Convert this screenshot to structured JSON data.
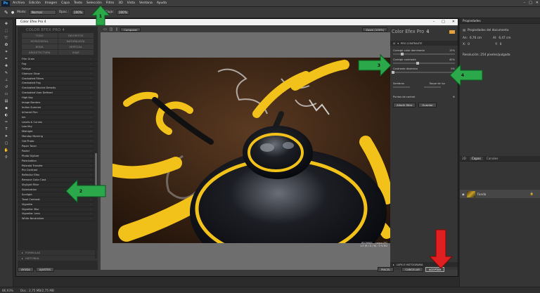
{
  "menubar": {
    "logo": "Ps",
    "items": [
      "Archivo",
      "Edición",
      "Imagen",
      "Capa",
      "Texto",
      "Selección",
      "Filtro",
      "3D",
      "Vista",
      "Ventana",
      "Ayuda"
    ]
  },
  "optbar": {
    "mode_label": "Modo:",
    "mode_value": "Normal",
    "opacity_label": "Opac.:",
    "opacity_value": "100%",
    "flow_label": "Flujo:",
    "flow_value": "100%"
  },
  "cep": {
    "window_title": "Color Efex Pro 4",
    "brand": "COLOR EFEX PRO 4",
    "categories": [
      "TODO",
      "FAVORITOS",
      "HORIZONTAL",
      "NATURALEZA",
      "BODA",
      "VERTICAL",
      "ARQUITECTURA",
      "VIAJE"
    ],
    "filters": [
      "Film Grain",
      "Fog",
      "Foliage",
      "Glamour Glow",
      "Graduated Filters",
      "Graduated Fog",
      "Graduated Neutral Density",
      "Graduated User Defined",
      "High Key",
      "Image Borders",
      "Indian Summer",
      "Infrared Film",
      "Ink",
      "Levels & Curves",
      "Low Key",
      "Midnight",
      "Monday Morning",
      "Old Photo",
      "Paper Toner",
      "Pastel",
      "Photo Stylizer",
      "Polarization",
      "Polaroid Transfer",
      "Pro Contrast",
      "Reflector Efex",
      "Remove Color Cast",
      "Skylight Filter",
      "Solarization",
      "Sunlight",
      "Tonal Contrast",
      "Vignette",
      "Vignette: Blur",
      "Vignette: Lens",
      "White Neutralizer"
    ],
    "sections": [
      "FORMULAS",
      "HISTORIAL"
    ],
    "left_buttons": [
      "AYUDA",
      "AJUSTES"
    ],
    "compare_label": "Comparar",
    "zoom_label": "Zoom (100%)",
    "logo_text": "Color Efex Pro",
    "logo_version": "4",
    "filter_section": "PRO CONTRASTE",
    "controls": [
      {
        "label": "Corregir color dominante",
        "value": "15%",
        "level": 0.15
      },
      {
        "label": "Corregir contraste",
        "value": "40%",
        "level": 0.4
      },
      {
        "label": "Contraste dinámico",
        "value": "0%",
        "level": 0.0
      }
    ],
    "shadows_label": "Sombras",
    "highlights_label": "Toque de luz",
    "control_points_label": "Puntos de control",
    "add_filter_label": "Añadir filtro",
    "save_label": "Guardar",
    "loupe_label": "LUPA E HISTOGRAMA",
    "brush_label": "PINCEL",
    "cancel_label": "CANCELAR",
    "accept_label": "ACEPTAR",
    "caption_line1": "IP279985... coque.JPG",
    "caption_line2": "1.0 (R / G / B) : 0 % RG"
  },
  "properties": {
    "tab": "Propiedades",
    "title": "Propiedades del documento",
    "w_label": "An:",
    "w_value": "6,76 cm",
    "h_label": "Al:",
    "h_value": "6,47 cm",
    "x_label": "X:",
    "x_value": "0",
    "y_label": "Y:",
    "y_value": "0",
    "resolution": "Resolución: 254 píxeles/pulgada"
  },
  "layers": {
    "tabs": [
      "3D",
      "Capas",
      "Canales"
    ],
    "layer_name": "Fondo"
  },
  "status": {
    "zoom": "86,93%",
    "doc": "Doc.: 2,75 MB/2,75 MB"
  },
  "callouts": [
    "1",
    "2",
    "3",
    "4"
  ],
  "colors": {
    "accent_green": "#2aa84a",
    "accent_red": "#e02020"
  }
}
